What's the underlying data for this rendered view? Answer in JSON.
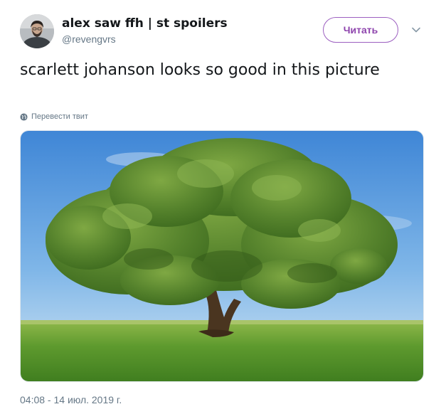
{
  "tweet": {
    "display_name": "alex saw ffh | st spoilers",
    "handle": "@revengvrs",
    "follow_label": "Читать",
    "text": "scarlett johanson looks so good in this picture",
    "translate_label": "Перевести твит",
    "timestamp": "04:08 - 14 июл. 2019 г."
  },
  "icons": {
    "avatar": "avatar",
    "caret": "chevron-down-icon",
    "globe": "globe-icon"
  },
  "colors": {
    "follow_accent": "#8e44ad",
    "secondary_text": "#657786",
    "primary_text": "#14171a"
  }
}
